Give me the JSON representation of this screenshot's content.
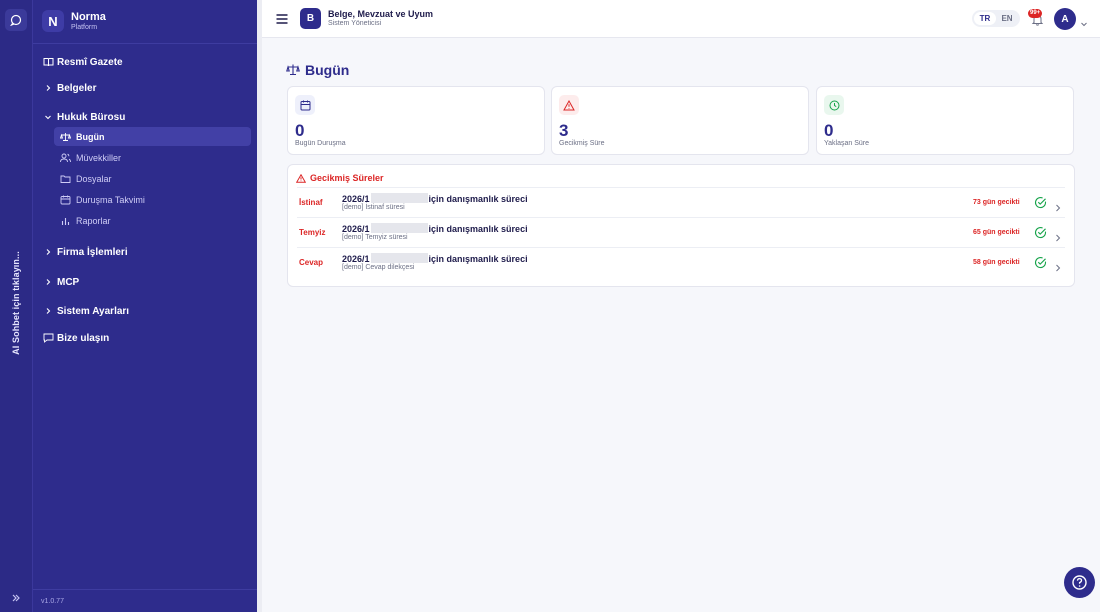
{
  "rail": {
    "vertical_label": "AI Sohbet için tıklayın..."
  },
  "brand": {
    "logo_letter": "N",
    "name": "Norma",
    "subtitle": "Platform"
  },
  "sidebar": {
    "items": [
      {
        "label": "Resmî Gazete",
        "icon": "book-icon"
      },
      {
        "label": "Belgeler",
        "icon": "chevron-right-icon"
      },
      {
        "label": "Hukuk Bürosu",
        "icon": "chevron-down-icon"
      },
      {
        "label": "Firma İşlemleri",
        "icon": "chevron-right-icon"
      },
      {
        "label": "MCP",
        "icon": "chevron-right-icon"
      },
      {
        "label": "Sistem Ayarları",
        "icon": "chevron-right-icon"
      },
      {
        "label": "Bize ulaşın",
        "icon": "message-icon"
      }
    ],
    "sub_items": [
      {
        "label": "Bugün",
        "icon": "scale-icon",
        "active": true
      },
      {
        "label": "Müvekkiller",
        "icon": "users-icon"
      },
      {
        "label": "Dosyalar",
        "icon": "folder-icon"
      },
      {
        "label": "Duruşma Takvimi",
        "icon": "calendar-icon"
      },
      {
        "label": "Raporlar",
        "icon": "bar-chart-icon"
      }
    ],
    "version": "v1.0.77"
  },
  "header": {
    "app_badge": "B",
    "title": "Belge, Mevzuat ve Uyum",
    "subtitle": "Sistem Yöneticisi",
    "lang_tr": "TR",
    "lang_en": "EN",
    "notification_count": "99+",
    "avatar_letter": "A"
  },
  "main": {
    "title": "Bugün",
    "cards": [
      {
        "value": "0",
        "label": "Bugün Duruşma",
        "icon": "calendar-icon",
        "color": "#2e2c8c"
      },
      {
        "value": "3",
        "label": "Gecikmiş Süre",
        "icon": "warning-icon",
        "color": "#dc2626"
      },
      {
        "value": "0",
        "label": "Yaklaşan Süre",
        "icon": "clock-icon",
        "color": "#16a34a"
      }
    ],
    "overdue": {
      "heading": "Gecikmiş Süreler",
      "rows": [
        {
          "tag": "İstinaf",
          "title_prefix": "2026/1",
          "title_suffix": "için danışmanlık süreci",
          "subtitle": "[demo] İstinaf süresi",
          "late": "73 gün gecikti"
        },
        {
          "tag": "Temyiz",
          "title_prefix": "2026/1",
          "title_suffix": "için danışmanlık süreci",
          "subtitle": "[demo] Temyiz süresi",
          "late": "65 gün gecikti"
        },
        {
          "tag": "Cevap",
          "title_prefix": "2026/1",
          "title_suffix": "için danışmanlık süreci",
          "subtitle": "[demo] Cevap dilekçesi",
          "late": "58 gün gecikti"
        }
      ]
    }
  },
  "colors": {
    "brand": "#2e2c8c",
    "danger": "#dc2626",
    "success": "#16a34a"
  }
}
